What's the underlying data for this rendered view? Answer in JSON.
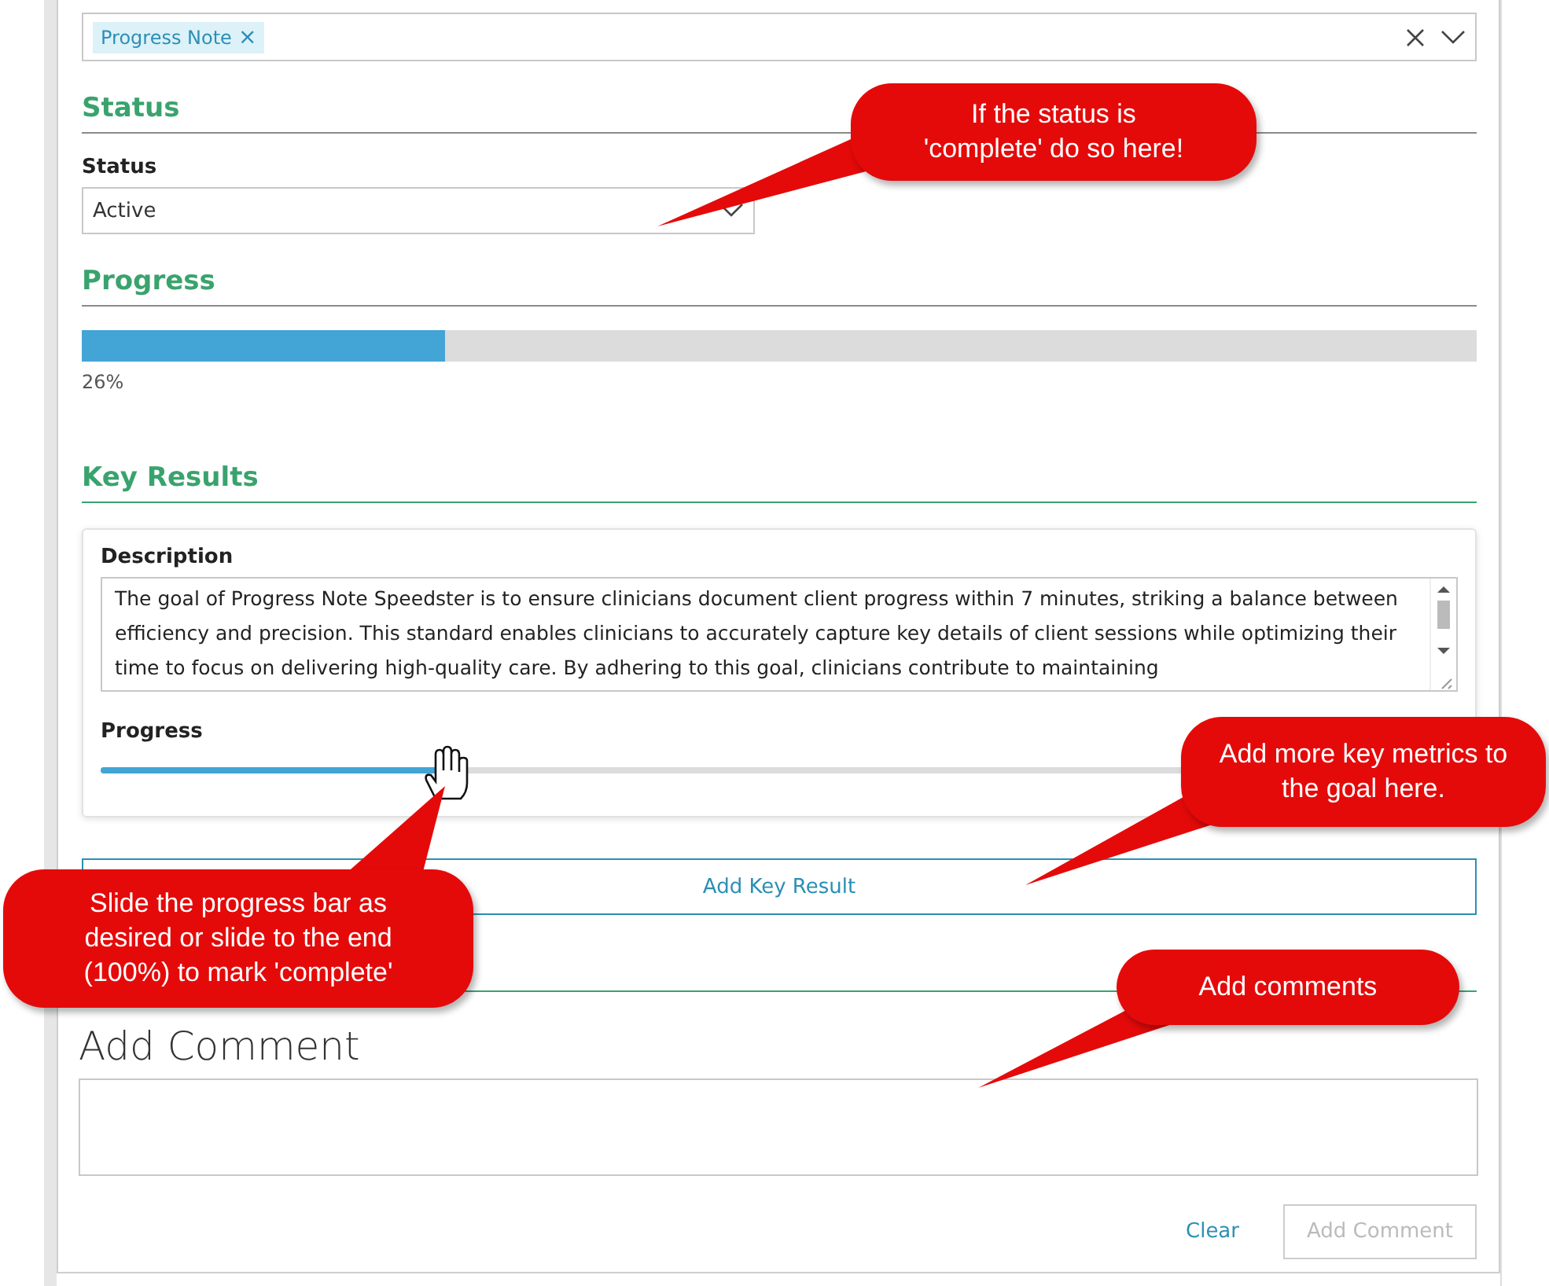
{
  "keywords": {
    "tags": [
      {
        "label": "Progress Note",
        "remove": "×"
      }
    ]
  },
  "status_section": {
    "heading": "Status",
    "label": "Status",
    "value": "Active"
  },
  "progress_section": {
    "heading": "Progress",
    "level": 0.26,
    "reading": "26%"
  },
  "key_results": {
    "heading": "Key Results",
    "items": [
      {
        "description_label": "Description",
        "description": "The goal of Progress Note Speedster is to ensure clinicians document client progress within 7 minutes, striking a balance between efficiency and precision. This standard enables clinicians to accurately capture key details of client sessions while optimizing their time to focus on delivering high-quality care. By adhering to this goal, clinicians contribute to maintaining",
        "progress_label": "Progress",
        "level": 0.26
      }
    ],
    "add_button": "Add Key Result"
  },
  "comment": {
    "heading": "Add Comment",
    "clear": "Clear",
    "submit": "Add Comment",
    "submit_disabled": true
  },
  "callouts": [
    {
      "text": "If the status is 'complete' do so here!"
    },
    {
      "text": "Add more key metrics to the goal here."
    },
    {
      "text": "Slide the progress bar as desired or slide to the end (100%) to mark 'complete'"
    },
    {
      "text": "Add comments"
    }
  ]
}
